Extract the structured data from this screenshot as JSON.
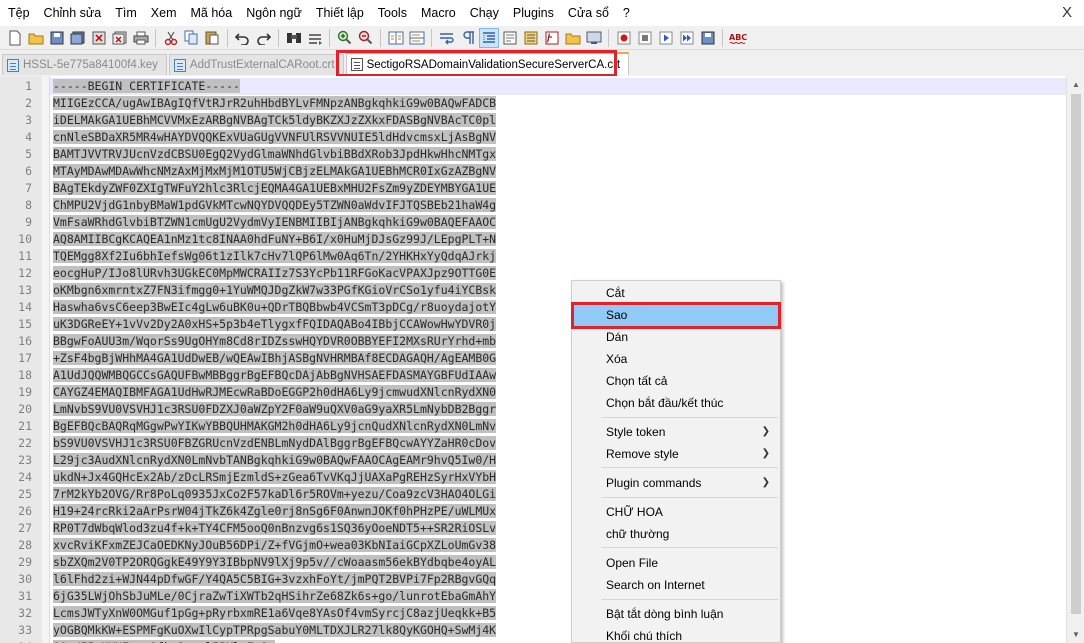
{
  "menu": {
    "items": [
      "Tệp",
      "Chỉnh sửa",
      "Tìm",
      "Xem",
      "Mã hóa",
      "Ngôn ngữ",
      "Thiết lập",
      "Tools",
      "Macro",
      "Chạy",
      "Plugins",
      "Cửa sổ",
      "?"
    ],
    "close_label": "X"
  },
  "tabs": [
    {
      "label": "HSSL-5e775a84100f4.key",
      "active": false
    },
    {
      "label": "AddTrustExternalCARoot.crt",
      "active": false
    },
    {
      "label": "SectigoRSADomainValidationSecureServerCA.crt",
      "active": true
    }
  ],
  "editor": {
    "lines": [
      "-----BEGIN CERTIFICATE-----",
      "MIIGEzCCA/ugAwIBAgIQfVtRJrR2uhHbdBYLvFMNpzANBgkqhkiG9w0BAQwFADCB",
      "iDELMAkGA1UEBhMCVVMxEzARBgNVBAgTCk5ldyBKZXJzZXkxFDASBgNVBAcTC0pl",
      "cnNleSBDaXR5MR4wHAYDVQQKExVUaGUgVVNFUlRSVVNUIE5ldHdvcmsxLjAsBgNV",
      "BAMTJVVTRVJUcnVzdCBSU0EgQ2VydGlmaWNhdGlvbiBBdXRob3JpdHkwHhcNMTgx",
      "MTAyMDAwMDAwWhcNMzAxMjMxMjM1OTU5WjCBjzELMAkGA1UEBhMCR0IxGzAZBgNV",
      "BAgTEkdyZWF0ZXIgTWFuY2hlc3RlcjEQMA4GA1UEBxMHU2FsZm9yZDEYMBYGA1UE",
      "ChMPU2VjdG1nbyBMaW1pdGVkMTcwNQYDVQQDEy5TZWN0aWdvIFJTQSBEb21haW4g",
      "VmFsaWRhdGlvbiBTZWN1cmUgU2VydmVyIENBMIIBIjANBgkqhkiG9w0BAQEFAAOC",
      "AQ8AMIIBCgKCAQEA1nMz1tc8INAA0hdFuNY+B6I/x0HuMjDJsGz99J/LEpgPLT+N",
      "TQEMgg8Xf2Iu6bhIefsWg06t1zIlk7cHv7lQP6lMw0Aq6Tn/2YHKHxYyQdqAJrkj",
      "eocgHuP/IJo8lURvh3UGkEC0MpMWCRAIIz7S3YcPb11RFGoKacVPAXJpz9OTTG0E",
      "oKMbgn6xmrntxZ7FN3ifmgg0+1YuWMQJDgZkW7w33PGfKGioVrCSo1yfu4iYCBsk",
      "Haswha6vsC6eep3BwEIc4gLw6uBK0u+QDrTBQBbwb4VCSmT3pDCg/r8uoydajotY",
      "uK3DGReEY+1vVv2Dy2A0xHS+5p3b4eTlygxfFQIDAQABo4IBbjCCAWowHwYDVR0j",
      "BBgwFoAUU3m/WqorSs9UgOHYm8Cd8rIDZsswHQYDVR0OBBYEFI2MXsRUrYrhd+mb",
      "+ZsF4bgBjWHhMA4GA1UdDwEB/wQEAwIBhjASBgNVHRMBAf8ECDAGAQH/AgEAMB0G",
      "A1UdJQQWMBQGCCsGAQUFBwMBBggrBgEFBQcDAjAbBgNVHSAEFDASMAYGBFUdIAAw",
      "CAYGZ4EMAQIBMFAGA1UdHwRJMEcwRaBDoEGGP2h0dHA6Ly9jcmwudXNlcnRydXN0",
      "LmNvbS9VU0VSVHJ1c3RSU0FDZXJ0aWZpY2F0aW9uQXV0aG9yaXR5LmNybDB2Bggr",
      "BgEFBQcBAQRqMGgwPwYIKwYBBQUHMAKGM2h0dHA6Ly9jcnQudXNlcnRydXN0LmNv",
      "bS9VU0VSVHJ1c3RSU0FBZGRUcnVzdENBLmNydDAlBggrBgEFBQcwAYYZaHR0cDov",
      "L29jc3AudXNlcnRydXN0LmNvbTANBgkqhkiG9w0BAQwFAAOCAgEAMr9hvQ5Iw0/H",
      "ukdN+Jx4GQHcEx2Ab/zDcLRSmjEzmldS+zGea6TvVKqJjUAXaPgREHzSyrHxVYbH",
      "7rM2kYb2OVG/Rr8PoLq0935JxCo2F57kaDl6r5ROVm+yezu/Coa9zcV3HAO4OLGi",
      "H19+24rcRki2aArPsrW04jTkZ6k4Zgle0rj8nSg6F0AnwnJOKf0hPHzPE/uWLMUx",
      "RP0T7dWbqWlod3zu4f+k+TY4CFM5ooQ0nBnzvg6s1SQ36yOoeNDT5++SR2RiOSLv",
      "xvcRviKFxmZEJCaOEDKNyJOuB56DPi/Z+fVGjmO+wea03KbNIaiGCpXZLoUmGv38",
      "sbZXQm2V0TP2ORQGgkE49Y9Y3IBbpNV9lXj9p5v//cWoaasm56ekBYdbqbe4oyAL",
      "l6lFhd2zi+WJN44pDfwGF/Y4QA5C5BIG+3vzxhFoYt/jmPQT2BVPi7Fp2RBgvGQq",
      "6jG35LWjOhSbJuMLe/0CjraZwTiXWTb2qHSihrZe68Zk6s+go/lunrotEbaGmAhY",
      "LcmsJWTyXnW0OMGuf1pGg+pRyrbxmRE1a6Vqe8YAsOf4vmSyrcjC8azjUeqkk+B5",
      "yOGBQMkKW+ESPMFgKuOXwIlCypTPRpgSabuY0MLTDXJLR27lk8QyKGOHQ+SwMj4K",
      "00u/I5sUKUErmgQfky3xxzlIPKlaEn8=",
      "-----END CERTIFICATE-----"
    ]
  },
  "context_menu": {
    "items": [
      {
        "label": "Cắt",
        "submenu": false
      },
      {
        "label": "Sao",
        "submenu": false,
        "highlighted": true
      },
      {
        "label": "Dán",
        "submenu": false
      },
      {
        "label": "Xóa",
        "submenu": false
      },
      {
        "label": "Chọn tất cả",
        "submenu": false
      },
      {
        "label": "Chọn bắt đầu/kết thúc",
        "submenu": false
      },
      {
        "label": "Style token",
        "submenu": true
      },
      {
        "label": "Remove style",
        "submenu": true
      },
      {
        "label": "Plugin commands",
        "submenu": true
      },
      {
        "label": "CHỮ HOA",
        "submenu": false
      },
      {
        "label": "chữ thường",
        "submenu": false
      },
      {
        "label": "Open File",
        "submenu": false
      },
      {
        "label": "Search on Internet",
        "submenu": false
      },
      {
        "label": "Bật tắt dòng bình luận",
        "submenu": false
      },
      {
        "label": "Khối chú thích",
        "submenu": false
      }
    ]
  },
  "colors": {
    "highlight_box": "#e0222b",
    "menu_hover": "#91c9f7",
    "selection": "#c0c0c0",
    "active_tab_accent": "#f2a54a"
  }
}
